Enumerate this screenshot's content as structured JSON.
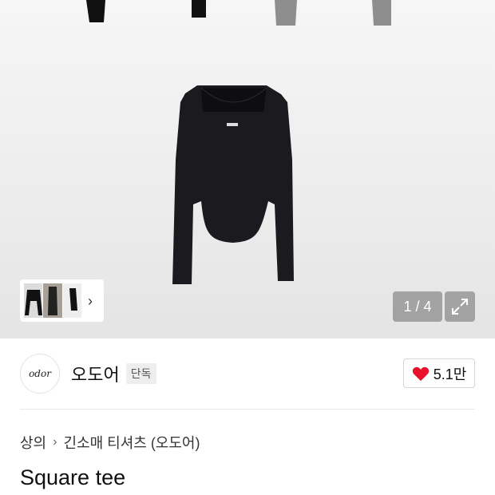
{
  "gallery": {
    "counter": "1 / 4",
    "thumbnails": [
      "thumbnail-front",
      "thumbnail-model",
      "thumbnail-side"
    ]
  },
  "brand": {
    "logo_text": "odor",
    "name": "오도어",
    "badge": "단독"
  },
  "like": {
    "count": "5.1만",
    "icon": "heart-icon",
    "color": "#e8102c"
  },
  "breadcrumb": {
    "category": "상의",
    "subcategory": "긴소매 티셔츠 (오도어)"
  },
  "product": {
    "title": "Square tee"
  }
}
